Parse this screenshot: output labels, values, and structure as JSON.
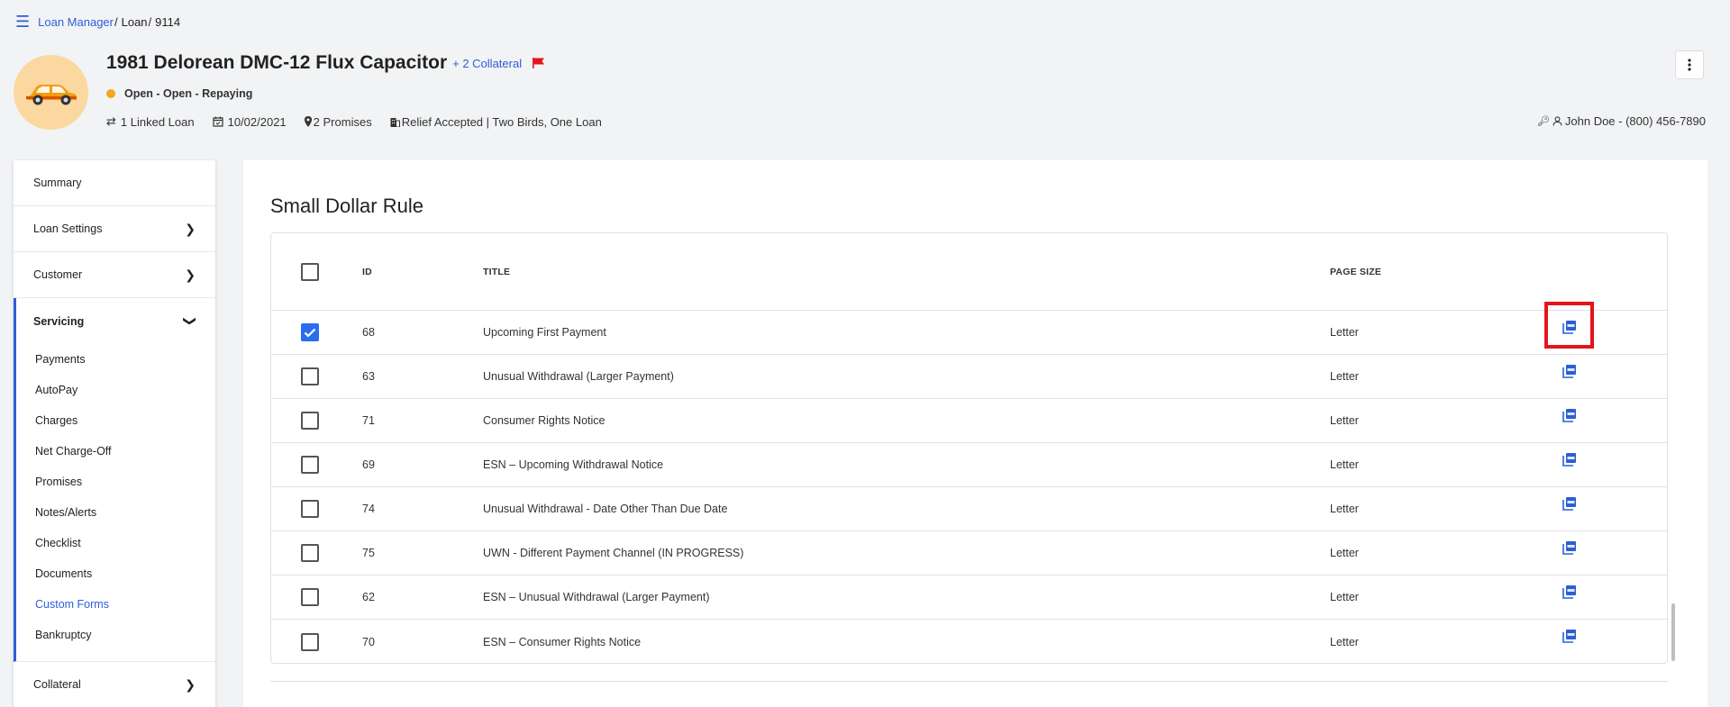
{
  "breadcrumb": {
    "menu_icon": "hamburger-icon",
    "items": [
      "Loan Manager",
      "Loan",
      "9114"
    ],
    "separator": "/"
  },
  "header": {
    "title": "1981 Delorean DMC-12 Flux Capacitor",
    "collateral_link": "+ 2 Collateral",
    "status": "Open - Open - Repaying",
    "status_color": "#f5a623",
    "meta": {
      "linked": "1 Linked Loan",
      "date": "10/02/2021",
      "promises": "2 Promises",
      "relief": "Relief Accepted | Two Birds, One Loan"
    },
    "contact": "John Doe - (800) 456-7890"
  },
  "sidebar": {
    "items": [
      {
        "label": "Summary"
      },
      {
        "label": "Loan Settings"
      },
      {
        "label": "Customer"
      }
    ],
    "servicing": {
      "label": "Servicing",
      "subitems": [
        "Payments",
        "AutoPay",
        "Charges",
        "Net Charge-Off",
        "Promises",
        "Notes/Alerts",
        "Checklist",
        "Documents",
        "Custom Forms",
        "Bankruptcy"
      ],
      "active": "Custom Forms"
    },
    "collateral": {
      "label": "Collateral"
    }
  },
  "main": {
    "section_title": "Small Dollar Rule",
    "columns": {
      "id": "ID",
      "title": "TITLE",
      "page_size": "PAGE SIZE"
    },
    "rows": [
      {
        "id": "68",
        "title": "Upcoming First Payment",
        "page_size": "Letter",
        "checked": true
      },
      {
        "id": "63",
        "title": "Unusual Withdrawal (Larger Payment)",
        "page_size": "Letter",
        "checked": false
      },
      {
        "id": "71",
        "title": "Consumer Rights Notice",
        "page_size": "Letter",
        "checked": false
      },
      {
        "id": "69",
        "title": "ESN – Upcoming Withdrawal Notice",
        "page_size": "Letter",
        "checked": false
      },
      {
        "id": "74",
        "title": "Unusual Withdrawal - Date Other Than Due Date",
        "page_size": "Letter",
        "checked": false
      },
      {
        "id": "75",
        "title": "UWN - Different Payment Channel (IN PROGRESS)",
        "page_size": "Letter",
        "checked": false
      },
      {
        "id": "62",
        "title": "ESN – Unusual Withdrawal (Larger Payment)",
        "page_size": "Letter",
        "checked": false
      },
      {
        "id": "70",
        "title": "ESN – Consumer Rights Notice",
        "page_size": "Letter",
        "checked": false
      }
    ]
  },
  "colors": {
    "accent": "#2c5fd6",
    "highlight": "#e3141c",
    "flag": "#e3141c"
  }
}
